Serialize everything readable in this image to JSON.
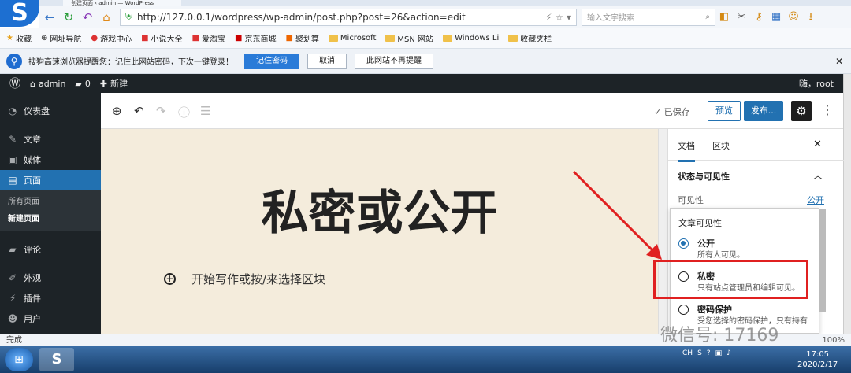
{
  "browser": {
    "tab_title": "创建页面 ‹ admin — WordPress",
    "url": "http://127.0.0.1/wordpress/wp-admin/post.php?post=26&action=edit",
    "search_placeholder": "输入文字搜索"
  },
  "bookmarks": [
    "收藏",
    "网址导航",
    "游戏中心",
    "小说大全",
    "爱淘宝",
    "京东商城",
    "聚划算",
    "Microsoft",
    "MSN 网站",
    "Windows Li",
    "收藏夹栏"
  ],
  "password_bar": {
    "message": "搜狗高速浏览器提醒您：记住此网站密码，下次一键登录！",
    "remember": "记住密码",
    "cancel": "取消",
    "never": "此网站不再提醒"
  },
  "adminbar": {
    "site": "admin",
    "comments": "0",
    "new": "新建",
    "greeting": "嗨，root"
  },
  "sidebar": {
    "dashboard": "仪表盘",
    "posts": "文章",
    "media": "媒体",
    "pages": "页面",
    "all_pages": "所有页面",
    "new_page": "新建页面",
    "comments": "评论",
    "appearance": "外观",
    "plugins": "插件",
    "users": "用户"
  },
  "editor": {
    "saved": "已保存",
    "preview": "预览",
    "publish": "发布...",
    "title": "私密或公开",
    "block_hint": "开始写作或按/来选择区块"
  },
  "panel": {
    "tab_document": "文档",
    "tab_block": "区块",
    "section": "状态与可见性",
    "visibility_label": "可见性",
    "visibility_value": "公开",
    "popover_title": "文章可见性",
    "options": [
      {
        "label": "公开",
        "desc": "所有人可见。",
        "checked": true
      },
      {
        "label": "私密",
        "desc": "只有站点管理员和编辑可见。",
        "checked": false
      },
      {
        "label": "密码保护",
        "desc": "受您选择的密码保护，只有持有",
        "checked": false
      }
    ]
  },
  "status": {
    "text": "完成",
    "zoom": "100%"
  },
  "taskbar": {
    "time": "17:05",
    "date": "2020/2/17",
    "lang": "CH"
  },
  "watermark": "微信号: 17169",
  "colors": {
    "wp_blue": "#2271b1",
    "highlight": "#e02020"
  }
}
